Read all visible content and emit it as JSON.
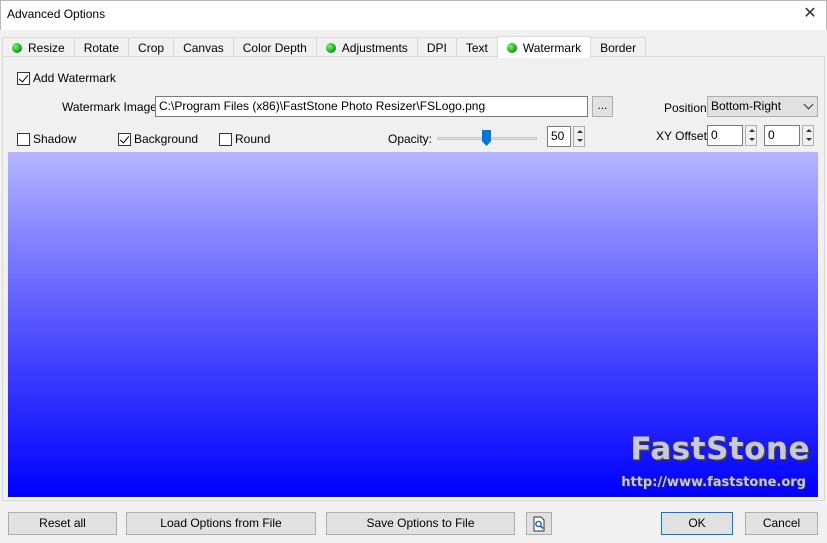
{
  "window": {
    "title": "Advanced Options",
    "close_glyph": "✕"
  },
  "tabs": [
    {
      "label": "Resize",
      "enabled_dot": true
    },
    {
      "label": "Rotate",
      "enabled_dot": false
    },
    {
      "label": "Crop",
      "enabled_dot": false
    },
    {
      "label": "Canvas",
      "enabled_dot": false
    },
    {
      "label": "Color Depth",
      "enabled_dot": false
    },
    {
      "label": "Adjustments",
      "enabled_dot": true
    },
    {
      "label": "DPI",
      "enabled_dot": false
    },
    {
      "label": "Text",
      "enabled_dot": false
    },
    {
      "label": "Watermark",
      "enabled_dot": true,
      "active": true
    },
    {
      "label": "Border",
      "enabled_dot": false
    }
  ],
  "watermark": {
    "add_label": "Add Watermark",
    "add_checked": true,
    "image_label": "Watermark Image:",
    "image_path": "C:\\Program Files (x86)\\FastStone Photo Resizer\\FSLogo.png",
    "browse_label": "...",
    "position_label": "Position:",
    "position_value": "Bottom-Right",
    "shadow_label": "Shadow",
    "shadow_checked": false,
    "background_label": "Background",
    "background_checked": true,
    "round_label": "Round",
    "round_checked": false,
    "opacity_label": "Opacity:",
    "opacity_value": "50",
    "offset_label": "XY Offset:",
    "offset_x": "0",
    "offset_y": "0"
  },
  "preview": {
    "logo_text": "FastStone",
    "url_text": "http://www.faststone.org",
    "gradient_top": "#b5b5ff",
    "gradient_bottom": "#0000ff"
  },
  "footer": {
    "reset_label": "Reset all",
    "load_label": "Load Options from File",
    "save_label": "Save Options to File",
    "preview_icon": "magnifier-document-icon",
    "ok_label": "OK",
    "cancel_label": "Cancel"
  }
}
